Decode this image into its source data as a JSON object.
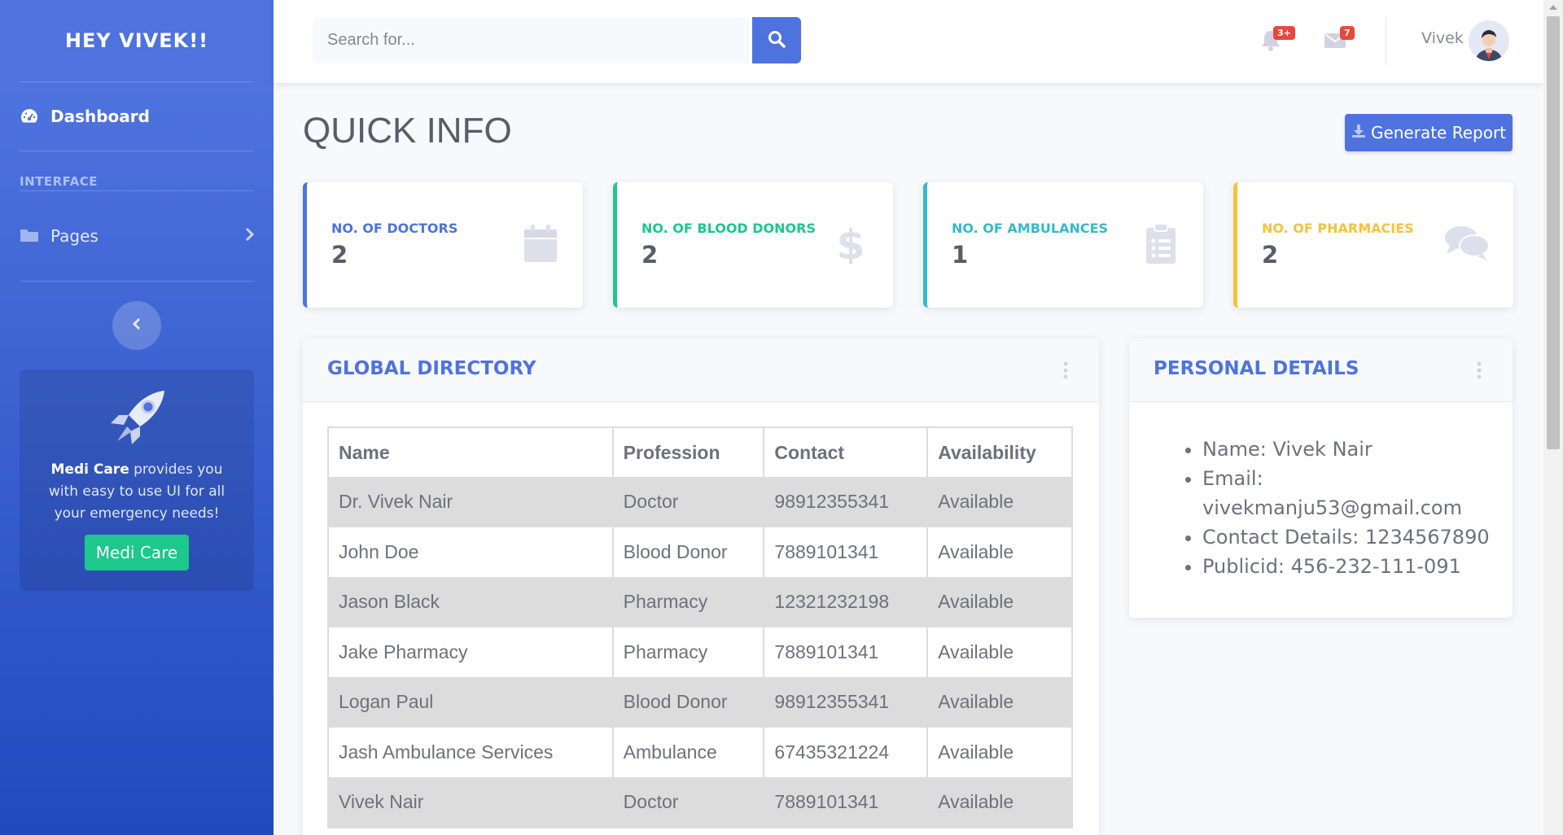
{
  "sidebar": {
    "brand": "HEY VIVEK!!",
    "dashboard_label": "Dashboard",
    "heading": "INTERFACE",
    "pages_label": "Pages",
    "promo": {
      "brand_bold": "Medi Care",
      "text": " provides you with easy to use UI for all your emergency needs!",
      "button_label": "Medi Care"
    }
  },
  "topbar": {
    "search_placeholder": "Search for...",
    "alerts_count": "3+",
    "messages_count": "7",
    "username": "Vivek"
  },
  "page": {
    "title": "QUICK INFO",
    "report_button": "Generate Report"
  },
  "stats": [
    {
      "label": "No. of Doctors",
      "value": "2",
      "color": "#4e73df",
      "icon": "calendar-icon"
    },
    {
      "label": "No. of Blood Donors",
      "value": "2",
      "color": "#1cc88a",
      "icon": "dollar-icon"
    },
    {
      "label": "No. of Ambulances",
      "value": "1",
      "color": "#36b9cc",
      "icon": "clipboard-list-icon"
    },
    {
      "label": "No. of Pharmacies",
      "value": "2",
      "color": "#f6c23e",
      "icon": "comments-icon"
    }
  ],
  "directory": {
    "title": "GLOBAL DIRECTORY",
    "columns": [
      "Name",
      "Profession",
      "Contact",
      "Availability"
    ],
    "rows": [
      [
        "Dr. Vivek Nair",
        "Doctor",
        "98912355341",
        "Available"
      ],
      [
        "John Doe",
        "Blood Donor",
        "7889101341",
        "Available"
      ],
      [
        "Jason Black",
        "Pharmacy",
        "12321232198",
        "Available"
      ],
      [
        "Jake Pharmacy",
        "Pharmacy",
        "7889101341",
        "Available"
      ],
      [
        "Logan Paul",
        "Blood Donor",
        "98912355341",
        "Available"
      ],
      [
        "Jash Ambulance Services",
        "Ambulance",
        "67435321224",
        "Available"
      ],
      [
        "Vivek Nair",
        "Doctor",
        "7889101341",
        "Available"
      ]
    ]
  },
  "personal": {
    "title": "PERSONAL DETAILS",
    "items": [
      "Name: Vivek Nair",
      "Email: vivekmanju53@gmail.com",
      "Contact Details: 1234567890",
      "Publicid: 456-232-111-091"
    ]
  }
}
